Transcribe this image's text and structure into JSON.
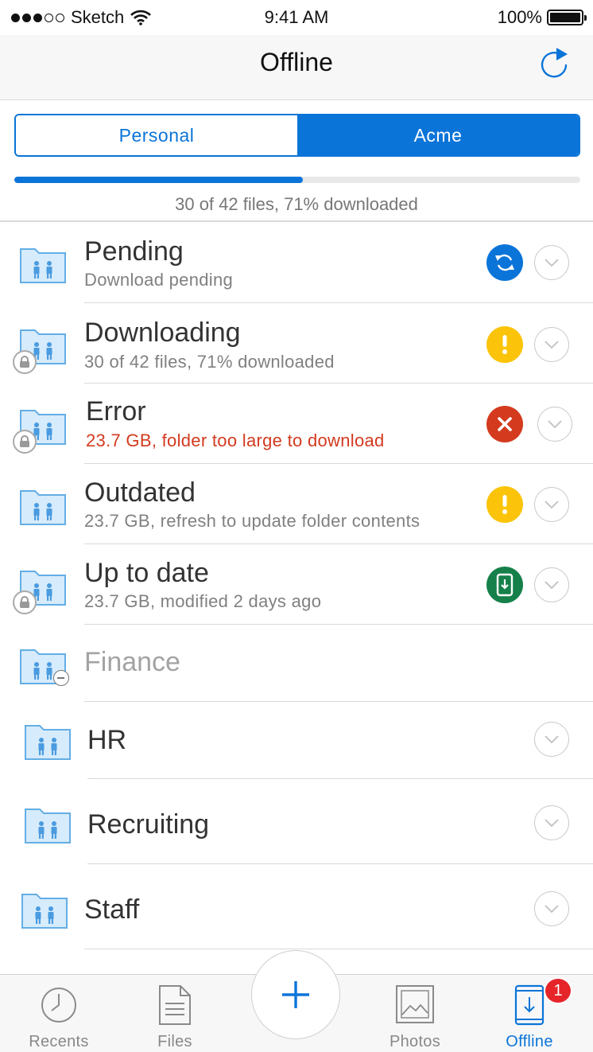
{
  "status_bar": {
    "carrier": "Sketch",
    "time": "9:41 AM",
    "battery": "100%"
  },
  "nav": {
    "title": "Offline"
  },
  "segments": [
    {
      "label": "Personal",
      "selected": false
    },
    {
      "label": "Acme",
      "selected": true
    }
  ],
  "progress": {
    "fraction": 0.51,
    "text": "30 of 42 files, 71% downloaded"
  },
  "rows": [
    {
      "title": "Pending",
      "subtitle": "Download pending",
      "status": "sync",
      "status_color": "#0b74d8",
      "locked": false
    },
    {
      "title": "Downloading",
      "subtitle": "30 of 42 files, 71% downloaded",
      "status": "warning",
      "status_color": "#fbc40a",
      "locked": true
    },
    {
      "title": "Error",
      "subtitle": "23.7 GB, folder too large to download",
      "status": "error",
      "status_color": "#d33a1e",
      "locked": true
    },
    {
      "title": "Outdated",
      "subtitle": "23.7 GB, refresh to update folder contents",
      "status": "warning",
      "status_color": "#fbc40a",
      "locked": false
    },
    {
      "title": "Up to date",
      "subtitle": "23.7 GB, modified 2 days ago",
      "status": "offline-ready",
      "status_color": "#16804a",
      "locked": true
    },
    {
      "title": "Finance",
      "disabled": true
    },
    {
      "title": "HR"
    },
    {
      "title": "Recruiting"
    },
    {
      "title": "Staff"
    }
  ],
  "tabs": [
    {
      "label": "Recents",
      "icon": "clock-icon"
    },
    {
      "label": "Files",
      "icon": "document-icon"
    },
    {
      "label": "Photos",
      "icon": "photo-icon"
    },
    {
      "label": "Offline",
      "icon": "offline-device-icon",
      "active": true,
      "badge": "1"
    }
  ],
  "colors": {
    "accent": "#0b74d8",
    "error": "#d33a1e",
    "warning": "#fbc40a",
    "success": "#16804a",
    "badge": "#e5252a"
  }
}
